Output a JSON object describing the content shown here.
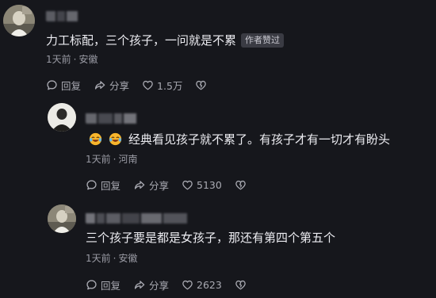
{
  "comments": [
    {
      "text": "力工标配，三个孩子，一问就是不累",
      "badge": "作者赞过",
      "time": "1天前",
      "location": "安徽",
      "reply_label": "回复",
      "share_label": "分享",
      "likes": "1.5万",
      "icons": {
        "reply": "comment-bubble-icon",
        "share": "share-arrow-icon",
        "like": "heart-icon",
        "dislike": "broken-heart-icon"
      }
    },
    {
      "text": "经典看见孩子就不累了。有孩子才有一切才有盼头",
      "emojis": [
        "laughing-crying-emoji",
        "laughing-crying-emoji"
      ],
      "time": "1天前",
      "location": "河南",
      "reply_label": "回复",
      "share_label": "分享",
      "likes": "5130"
    },
    {
      "text": "三个孩子要是都是女孩子，那还有第四个第五个",
      "time": "1天前",
      "location": "安徽",
      "reply_label": "回复",
      "share_label": "分享",
      "likes": "2623"
    }
  ],
  "colors": {
    "background": "#16171c",
    "text": "#ececf1",
    "meta": "#9a9ba4",
    "badge_bg": "#3a3b43"
  }
}
